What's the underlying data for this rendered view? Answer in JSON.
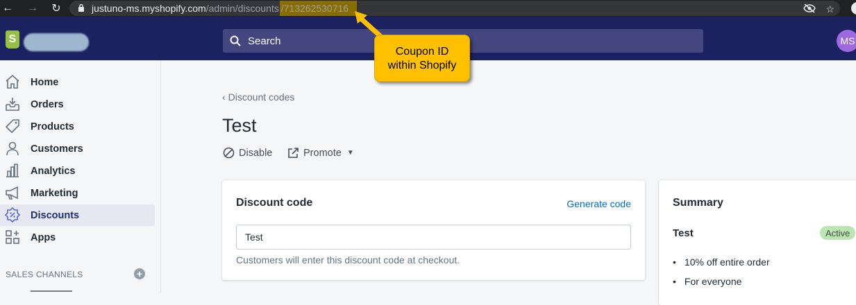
{
  "browser": {
    "url_host": "justuno-ms.myshopify.com",
    "url_path": "/admin/discounts",
    "url_id": "/713262530716"
  },
  "topbar": {
    "search_label": "Search",
    "avatar_initials": "MS"
  },
  "sidebar": {
    "items": [
      {
        "label": "Home",
        "icon": "home-icon"
      },
      {
        "label": "Orders",
        "icon": "orders-icon"
      },
      {
        "label": "Products",
        "icon": "tag-icon"
      },
      {
        "label": "Customers",
        "icon": "person-icon"
      },
      {
        "label": "Analytics",
        "icon": "bar-chart-icon"
      },
      {
        "label": "Marketing",
        "icon": "megaphone-icon"
      },
      {
        "label": "Discounts",
        "icon": "discount-icon",
        "active": true
      },
      {
        "label": "Apps",
        "icon": "apps-icon"
      }
    ],
    "sales_channels_heading": "SALES CHANNELS"
  },
  "main": {
    "breadcrumb": "Discount codes",
    "title": "Test",
    "actions": {
      "disable_label": "Disable",
      "promote_label": "Promote"
    },
    "discount_card": {
      "title": "Discount code",
      "generate_link": "Generate code",
      "code_value": "Test",
      "help_text": "Customers will enter this discount code at checkout."
    },
    "summary_card": {
      "title": "Summary",
      "code": "Test",
      "status": "Active",
      "details": [
        "10% off entire order",
        "For everyone"
      ]
    }
  },
  "annotation": {
    "line1": "Coupon ID",
    "line2": "within Shopify"
  },
  "colors": {
    "topbar": "#1c2260",
    "active_nav": "#e6e8f1",
    "link": "#006fbb",
    "badge": "#bbe5b3",
    "callout": "#ffc000",
    "url_highlight": "#8a6d00"
  }
}
